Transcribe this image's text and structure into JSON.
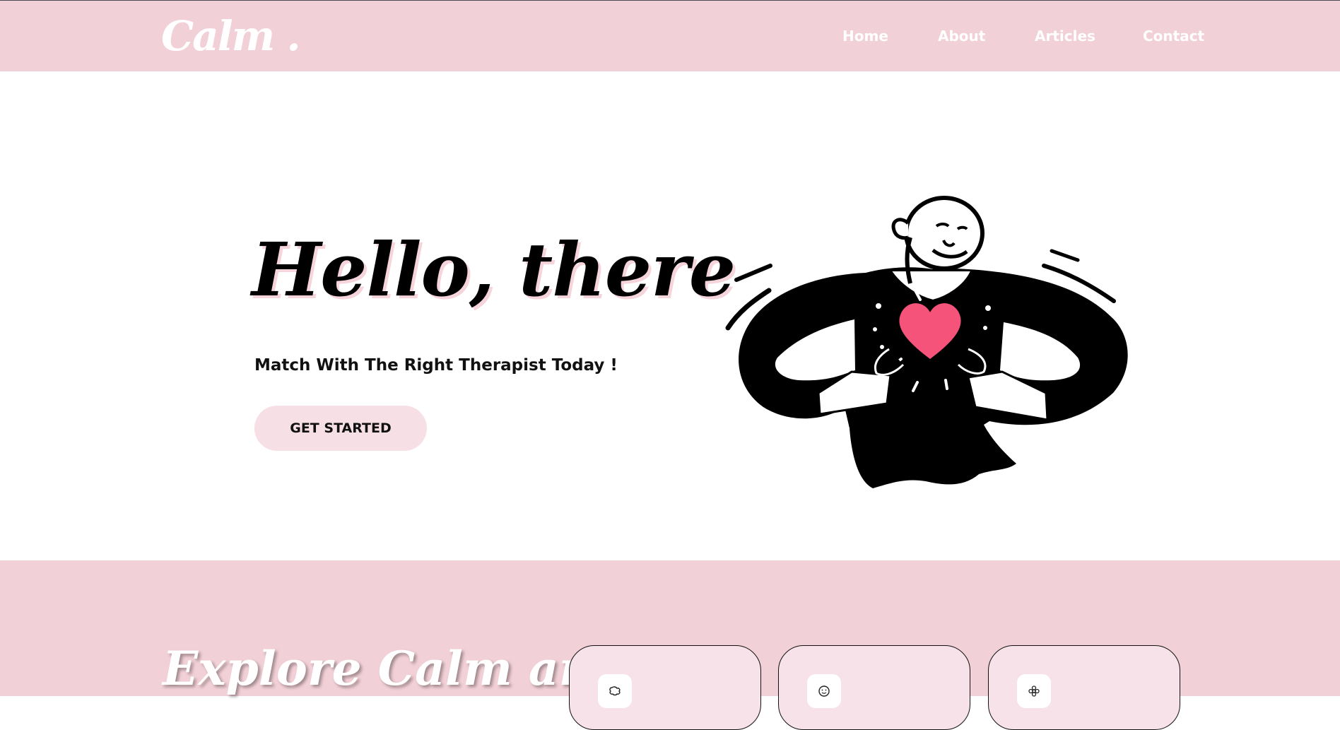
{
  "brand": {
    "logo_text": "Calm .",
    "primary_pink": "#f2d0d7",
    "light_pink": "#f6e0e6",
    "heart_color": "#f5537a"
  },
  "nav": {
    "items": [
      {
        "label": "Home"
      },
      {
        "label": "About"
      },
      {
        "label": "Articles"
      },
      {
        "label": "Contact"
      }
    ]
  },
  "hero": {
    "title": "Hello, there",
    "subtitle": "Match With The Right Therapist Today !",
    "cta_label": "GET STARTED",
    "illustration": "person-holding-heart"
  },
  "explore": {
    "title": "Explore Calm and",
    "cards": [
      {
        "icon": "brain-icon"
      },
      {
        "icon": "smiley-icon"
      },
      {
        "icon": "flower-icon"
      }
    ]
  }
}
